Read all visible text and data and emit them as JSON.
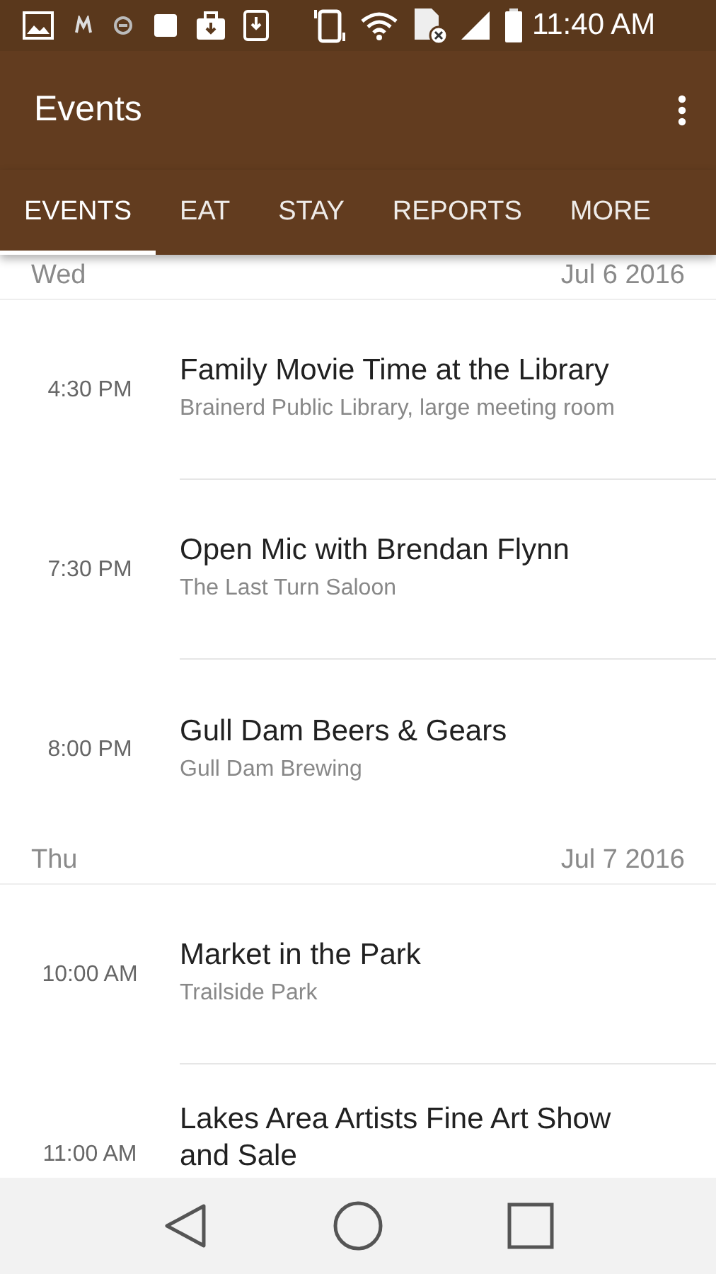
{
  "status_bar": {
    "time": "11:40 AM"
  },
  "toolbar": {
    "title": "Events"
  },
  "tabs": [
    {
      "label": "EVENTS",
      "selected": true
    },
    {
      "label": "EAT",
      "selected": false
    },
    {
      "label": "STAY",
      "selected": false
    },
    {
      "label": "REPORTS",
      "selected": false
    },
    {
      "label": "MORE",
      "selected": false
    }
  ],
  "days": [
    {
      "weekday": "Wed",
      "date": "Jul 6 2016",
      "events": [
        {
          "time": "4:30 PM",
          "title": "Family Movie Time at the Library",
          "venue": "Brainerd Public Library, large meeting room"
        },
        {
          "time": "7:30 PM",
          "title": "Open Mic with Brendan Flynn",
          "venue": "The Last Turn Saloon"
        },
        {
          "time": "8:00 PM",
          "title": "Gull Dam Beers & Gears",
          "venue": "Gull Dam Brewing"
        }
      ]
    },
    {
      "weekday": "Thu",
      "date": "Jul 7 2016",
      "events": [
        {
          "time": "10:00 AM",
          "title": "Market in the Park",
          "venue": "Trailside Park"
        },
        {
          "time": "11:00 AM",
          "title": "Lakes Area Artists Fine Art Show and Sale"
        }
      ]
    }
  ]
}
